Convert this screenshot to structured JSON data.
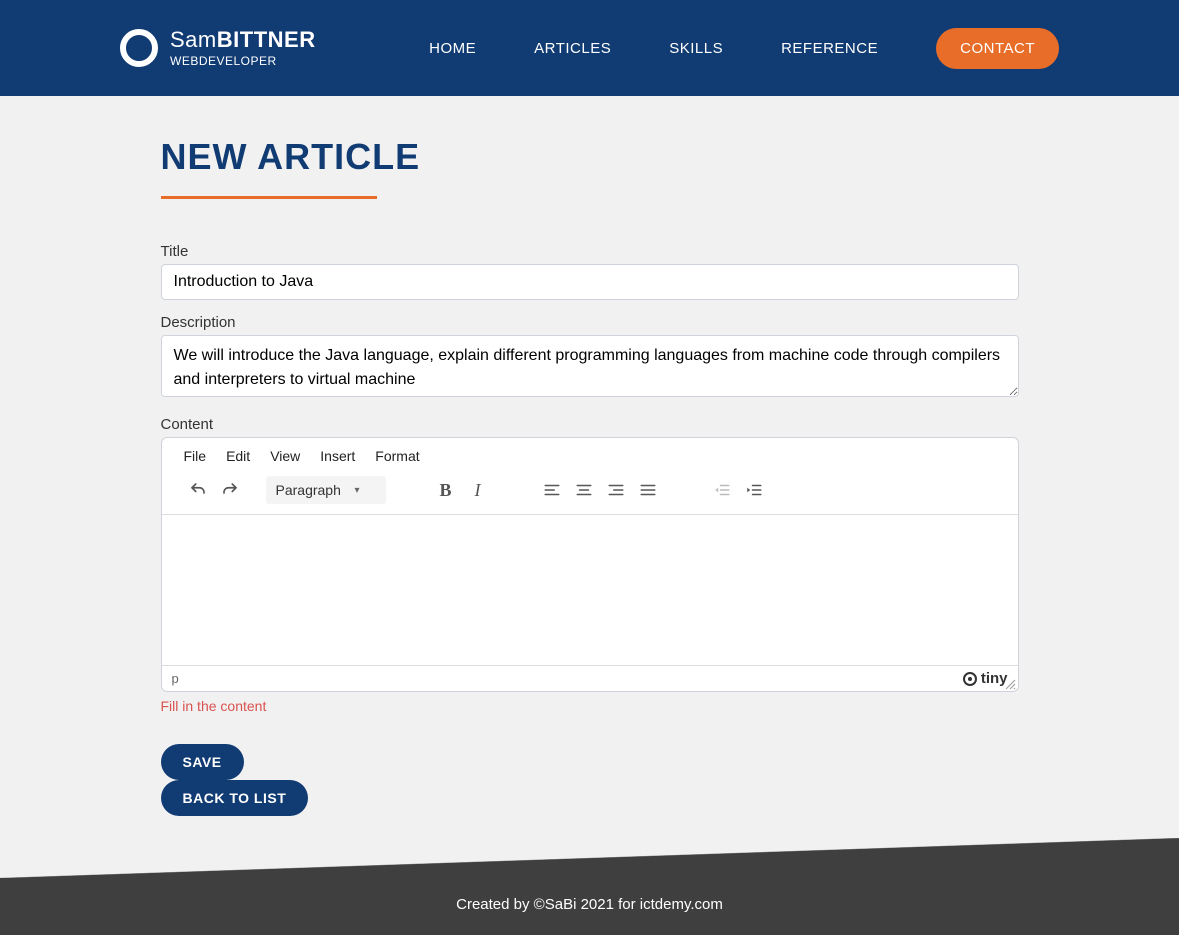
{
  "brand": {
    "name_first": "Sam",
    "name_last": "BITTNER",
    "subtitle": "WEBDEVELOPER"
  },
  "nav": {
    "home": "HOME",
    "articles": "ARTICLES",
    "skills": "SKILLS",
    "reference": "REFERENCE",
    "contact": "CONTACT"
  },
  "page": {
    "title": "NEW ARTICLE"
  },
  "form": {
    "title_label": "Title",
    "title_value": "Introduction to Java",
    "description_label": "Description",
    "description_value": "We will introduce the Java language, explain different programming languages from machine code through compilers and interpreters to virtual machine",
    "content_label": "Content",
    "error": "Fill in the content",
    "save": "SAVE",
    "back": "BACK TO LIST"
  },
  "editor": {
    "menu": {
      "file": "File",
      "edit": "Edit",
      "view": "View",
      "insert": "Insert",
      "format": "Format"
    },
    "format_select": "Paragraph",
    "status_path": "p",
    "brand": "tiny"
  },
  "footer": {
    "text": "Created by ©SaBi 2021 for ictdemy.com"
  }
}
